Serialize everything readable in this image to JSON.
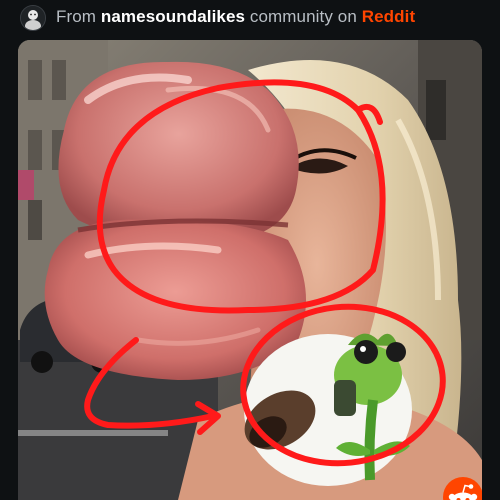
{
  "header": {
    "prefix": "From ",
    "community": "namesoundalikes",
    "middle": " community on ",
    "platform": "Reddit"
  },
  "colors": {
    "background": "#0e1113",
    "muted_text": "#b8bec4",
    "brand": "#ff4500",
    "annotation_red": "#ff1a1a"
  },
  "icons": {
    "community_avatar": "community-avatar-icon",
    "reddit_logo": "reddit-snoo-icon"
  }
}
